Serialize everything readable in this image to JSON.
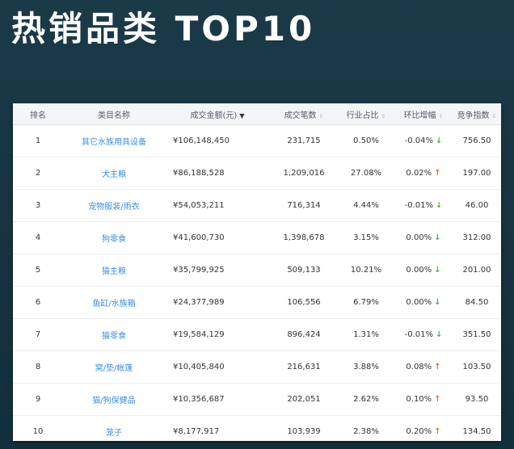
{
  "title": "热销品类 TOP10",
  "table": {
    "headers": {
      "rank": "排名",
      "category": "类目名称",
      "amount": "成交金额(元)",
      "count": "成交笔数",
      "share": "行业占比",
      "change": "环比增幅",
      "competition": "竞争指数"
    },
    "sort_active_icon": "sort-desc-icon",
    "sort_icon": "sort-both-icon",
    "rows": [
      {
        "rank": "1",
        "category": "其它水族用具设备",
        "amount": "¥106,148,450",
        "count": "231,715",
        "share": "0.50%",
        "change": "-0.04%",
        "trend": "down",
        "competition": "756.50"
      },
      {
        "rank": "2",
        "category": "犬主粮",
        "amount": "¥86,188,528",
        "count": "1,209,016",
        "share": "27.08%",
        "change": "0.02%",
        "trend": "up",
        "competition": "197.00"
      },
      {
        "rank": "3",
        "category": "宠物服装/雨衣",
        "amount": "¥54,053,211",
        "count": "716,314",
        "share": "4.44%",
        "change": "-0.01%",
        "trend": "down",
        "competition": "46.00"
      },
      {
        "rank": "4",
        "category": "狗零食",
        "amount": "¥41,600,730",
        "count": "1,398,678",
        "share": "3.15%",
        "change": "0.00%",
        "trend": "down",
        "competition": "312.00"
      },
      {
        "rank": "5",
        "category": "猫主粮",
        "amount": "¥35,799,925",
        "count": "509,133",
        "share": "10.21%",
        "change": "0.00%",
        "trend": "down",
        "competition": "201.00"
      },
      {
        "rank": "6",
        "category": "鱼缸/水族箱",
        "amount": "¥24,377,989",
        "count": "106,556",
        "share": "6.79%",
        "change": "0.00%",
        "trend": "down",
        "competition": "84.50"
      },
      {
        "rank": "7",
        "category": "猫零食",
        "amount": "¥19,584,129",
        "count": "896,424",
        "share": "1.31%",
        "change": "-0.01%",
        "trend": "down",
        "competition": "351.50"
      },
      {
        "rank": "8",
        "category": "窝/垫/帐篷",
        "amount": "¥10,405,840",
        "count": "216,631",
        "share": "3.88%",
        "change": "0.08%",
        "trend": "up",
        "competition": "103.50"
      },
      {
        "rank": "9",
        "category": "猫/狗保健品",
        "amount": "¥10,356,687",
        "count": "202,051",
        "share": "2.62%",
        "change": "0.10%",
        "trend": "up",
        "competition": "93.50"
      },
      {
        "rank": "10",
        "category": "笼子",
        "amount": "¥8,177,917",
        "count": "103,939",
        "share": "2.38%",
        "change": "0.20%",
        "trend": "up",
        "competition": "134.50"
      }
    ]
  },
  "colors": {
    "background": "#173340",
    "link": "#3a8ee6",
    "trend_up": "#f06b2a",
    "trend_down": "#4caf50"
  }
}
